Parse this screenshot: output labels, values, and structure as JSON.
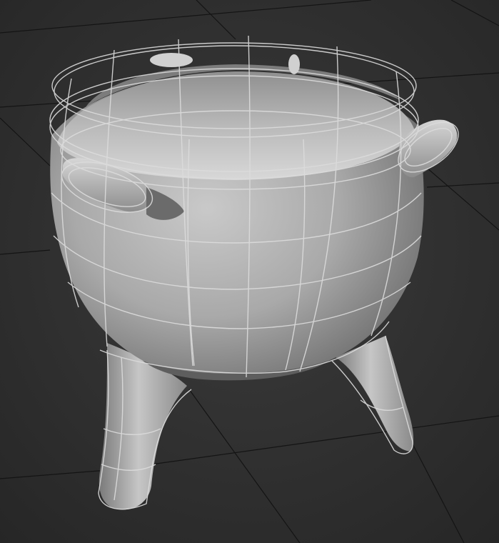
{
  "viewport": {
    "view": "perspective",
    "shading": "default-shading-with-edged-faces",
    "background_color": "#2e2e2e",
    "grid_color": "#121212"
  },
  "scene": {
    "object_type": "cauldron-mesh",
    "mesh_color": "#b4b4b4",
    "wire_color": "#dcdcdc"
  }
}
